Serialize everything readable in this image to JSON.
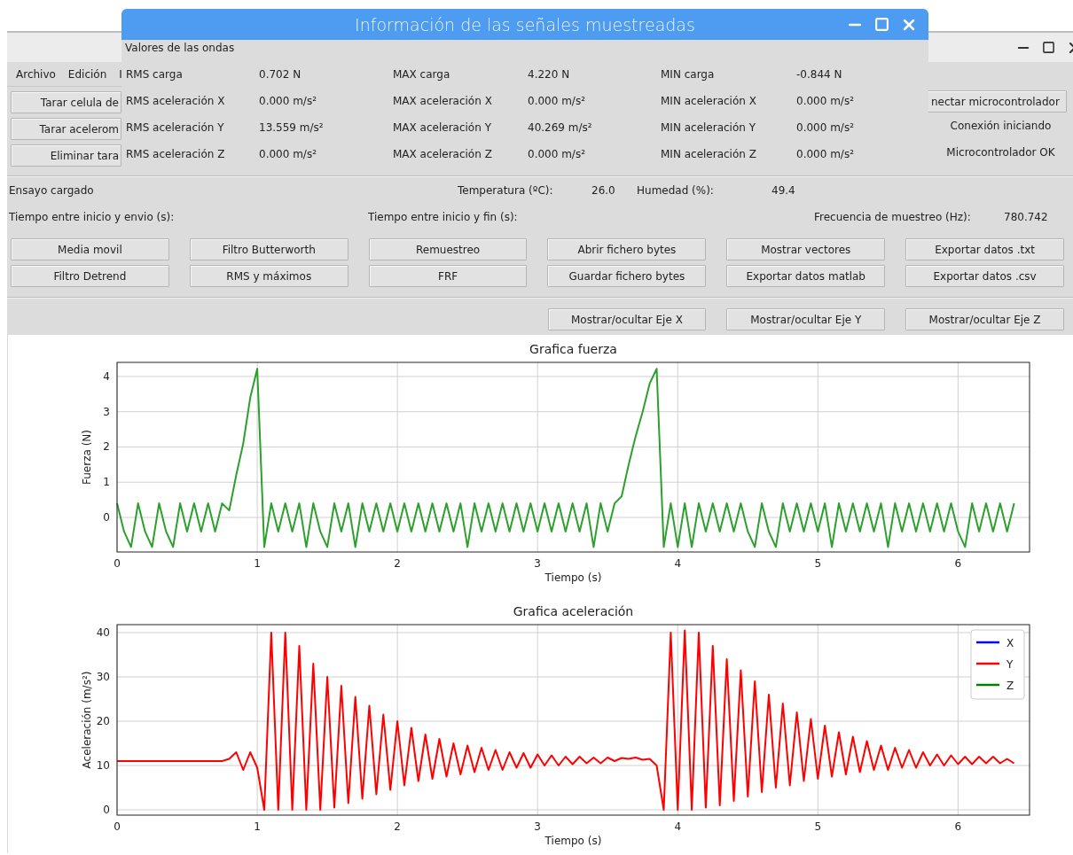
{
  "dialog": {
    "title": "Información de las señales muestreadas",
    "section": "Valores de las ondas",
    "rows": [
      [
        "RMS carga",
        "0.702 N",
        "MAX carga",
        "4.220 N",
        "MIN carga",
        "-0.844 N"
      ],
      [
        "RMS aceleración X",
        "0.000 m/s²",
        "MAX aceleración X",
        "0.000 m/s²",
        "MIN aceleración X",
        "0.000 m/s²"
      ],
      [
        "RMS aceleración Y",
        "13.559 m/s²",
        "MAX aceleración Y",
        "40.269 m/s²",
        "MIN aceleración Y",
        "0.000 m/s²"
      ],
      [
        "RMS aceleración Z",
        "0.000 m/s²",
        "MAX aceleración Z",
        "0.000 m/s²",
        "MIN aceleración Z",
        "0.000 m/s²"
      ]
    ]
  },
  "main_window": {
    "menu": [
      "Archivo",
      "Edición",
      "I"
    ],
    "left_buttons": [
      "Tarar celula de",
      "Tarar acelerom",
      "Eliminar tara"
    ],
    "right_button": "nectar microcontrolador",
    "status_labels": [
      "Conexión iniciando",
      "Microcontrolador OK"
    ]
  },
  "info": {
    "status": "Ensayo cargado",
    "temperature_label": "Temperatura (ºC):",
    "temperature_value": "26.0",
    "humidity_label": "Humedad (%):",
    "humidity_value": "49.4",
    "send_time_label": "Tiempo entre inicio y envio (s):",
    "end_time_label": "Tiempo entre inicio y fin (s):",
    "frequency_label": "Frecuencia de muestreo (Hz):",
    "frequency_value": "780.742"
  },
  "action_buttons": [
    "Media movil",
    "Filtro Butterworth",
    "Remuestreo",
    "Abrir fichero bytes",
    "Mostrar vectores",
    "Exportar datos .txt",
    "Filtro Detrend",
    "RMS y máximos",
    "FRF",
    "Guardar fichero bytes",
    "Exportar datos matlab",
    "Exportar datos .csv"
  ],
  "axis_buttons": [
    "Mostrar/ocultar Eje X",
    "Mostrar/ocultar Eje Y",
    "Mostrar/ocultar Eje Z"
  ],
  "charts": [
    {
      "chart_data": {
        "type": "line",
        "title": "Grafica fuerza",
        "xlabel": "Tiempo (s)",
        "ylabel": "Fuerza (N)",
        "xlim": [
          0,
          6.51
        ],
        "ylim": [
          -0.98,
          4.4
        ],
        "xticks": [
          0,
          1,
          2,
          3,
          4,
          5,
          6
        ],
        "yticks": [
          0,
          1,
          2,
          3,
          4
        ],
        "x": [
          0,
          0.05,
          0.1,
          0.15,
          0.2,
          0.25,
          0.3,
          0.35,
          0.4,
          0.45,
          0.5,
          0.55,
          0.6,
          0.65,
          0.7,
          0.75,
          0.8,
          0.85,
          0.9,
          0.95,
          1,
          1.05,
          1.1,
          1.15,
          1.2,
          1.25,
          1.3,
          1.35,
          1.4,
          1.45,
          1.5,
          1.55,
          1.6,
          1.65,
          1.7,
          1.75,
          1.8,
          1.85,
          1.9,
          1.95,
          2,
          2.05,
          2.1,
          2.15,
          2.2,
          2.25,
          2.3,
          2.35,
          2.4,
          2.45,
          2.5,
          2.55,
          2.6,
          2.65,
          2.7,
          2.75,
          2.8,
          2.85,
          2.9,
          2.95,
          3,
          3.05,
          3.1,
          3.15,
          3.2,
          3.25,
          3.3,
          3.35,
          3.4,
          3.45,
          3.5,
          3.55,
          3.6,
          3.65,
          3.7,
          3.75,
          3.8,
          3.85,
          3.9,
          3.95,
          4,
          4.05,
          4.1,
          4.15,
          4.2,
          4.25,
          4.3,
          4.35,
          4.4,
          4.45,
          4.5,
          4.55,
          4.6,
          4.65,
          4.7,
          4.75,
          4.8,
          4.85,
          4.9,
          4.95,
          5,
          5.05,
          5.1,
          5.15,
          5.2,
          5.25,
          5.3,
          5.35,
          5.4,
          5.45,
          5.5,
          5.55,
          5.6,
          5.65,
          5.7,
          5.75,
          5.8,
          5.85,
          5.9,
          5.95,
          6,
          6.05,
          6.1,
          6.15,
          6.2,
          6.25,
          6.3,
          6.35,
          6.4
        ],
        "grid": true,
        "series": [
          {
            "color": "#2ca02c",
            "values": [
              0.4,
              -0.4,
              -0.84,
              0.4,
              -0.4,
              -0.84,
              0.4,
              -0.4,
              -0.84,
              0.4,
              -0.4,
              0.4,
              -0.4,
              0.4,
              -0.4,
              0.4,
              0.2,
              1.2,
              2.1,
              3.4,
              4.22,
              -0.84,
              0.4,
              -0.4,
              0.4,
              -0.4,
              0.4,
              -0.84,
              0.4,
              -0.4,
              -0.84,
              0.4,
              -0.4,
              0.4,
              -0.84,
              0.4,
              -0.4,
              0.4,
              -0.4,
              0.4,
              -0.4,
              0.4,
              -0.4,
              0.4,
              -0.4,
              0.4,
              -0.4,
              0.4,
              -0.4,
              0.4,
              -0.84,
              0.4,
              -0.4,
              0.4,
              -0.4,
              0.4,
              -0.4,
              0.4,
              -0.4,
              0.4,
              -0.4,
              0.4,
              -0.4,
              0.4,
              -0.4,
              0.4,
              -0.4,
              0.4,
              -0.84,
              0.4,
              -0.4,
              0.4,
              0.6,
              1.5,
              2.3,
              3.0,
              3.8,
              4.22,
              -0.84,
              0.4,
              -0.84,
              0.4,
              -0.84,
              0.4,
              -0.4,
              0.4,
              -0.4,
              0.4,
              -0.4,
              0.4,
              -0.4,
              -0.84,
              0.4,
              -0.4,
              -0.84,
              0.4,
              -0.4,
              0.4,
              -0.4,
              0.4,
              -0.4,
              0.4,
              -0.84,
              0.4,
              -0.4,
              0.4,
              -0.4,
              0.4,
              -0.4,
              0.4,
              -0.84,
              0.4,
              -0.4,
              0.4,
              -0.4,
              0.4,
              -0.4,
              0.4,
              -0.4,
              0.4,
              -0.4,
              -0.84,
              0.4,
              -0.4,
              0.4,
              -0.4,
              0.4,
              -0.4,
              0.4
            ]
          }
        ]
      }
    },
    {
      "chart_data": {
        "type": "line",
        "title": "Grafica aceleración",
        "xlabel": "Tiempo (s)",
        "ylabel": "Aceleración (m/s²)",
        "xlim": [
          0,
          6.51
        ],
        "ylim": [
          -1.2,
          41.8
        ],
        "xticks": [
          0,
          1,
          2,
          3,
          4,
          5,
          6
        ],
        "yticks": [
          0,
          10,
          20,
          30,
          40
        ],
        "x": [
          0,
          0.05,
          0.1,
          0.15,
          0.2,
          0.25,
          0.3,
          0.35,
          0.4,
          0.45,
          0.5,
          0.55,
          0.6,
          0.65,
          0.7,
          0.75,
          0.8,
          0.85,
          0.9,
          0.95,
          1,
          1.05,
          1.1,
          1.15,
          1.2,
          1.25,
          1.3,
          1.35,
          1.4,
          1.45,
          1.5,
          1.55,
          1.6,
          1.65,
          1.7,
          1.75,
          1.8,
          1.85,
          1.9,
          1.95,
          2,
          2.05,
          2.1,
          2.15,
          2.2,
          2.25,
          2.3,
          2.35,
          2.4,
          2.45,
          2.5,
          2.55,
          2.6,
          2.65,
          2.7,
          2.75,
          2.8,
          2.85,
          2.9,
          2.95,
          3,
          3.05,
          3.1,
          3.15,
          3.2,
          3.25,
          3.3,
          3.35,
          3.4,
          3.45,
          3.5,
          3.55,
          3.6,
          3.65,
          3.7,
          3.75,
          3.8,
          3.85,
          3.9,
          3.95,
          4,
          4.05,
          4.1,
          4.15,
          4.2,
          4.25,
          4.3,
          4.35,
          4.4,
          4.45,
          4.5,
          4.55,
          4.6,
          4.65,
          4.7,
          4.75,
          4.8,
          4.85,
          4.9,
          4.95,
          5,
          5.05,
          5.1,
          5.15,
          5.2,
          5.25,
          5.3,
          5.35,
          5.4,
          5.45,
          5.5,
          5.55,
          5.6,
          5.65,
          5.7,
          5.75,
          5.8,
          5.85,
          5.9,
          5.95,
          6,
          6.05,
          6.1,
          6.15,
          6.2,
          6.25,
          6.3,
          6.35,
          6.4
        ],
        "grid": true,
        "series": [
          {
            "name": "X",
            "color": "#0000ff",
            "values": [
              null,
              null,
              null,
              null,
              null,
              null,
              null,
              null,
              null,
              null,
              null,
              null,
              null,
              null,
              null,
              null,
              null,
              null,
              null,
              null,
              null,
              null,
              null,
              null,
              null,
              null,
              null,
              null,
              null,
              null,
              null,
              null,
              null,
              null,
              null,
              null,
              null,
              null,
              null,
              null,
              null,
              null,
              null,
              null,
              null,
              null,
              null,
              null,
              null,
              null,
              null,
              null,
              null,
              null,
              null,
              null,
              null,
              null,
              null,
              null,
              null,
              null,
              null,
              null,
              null,
              null,
              null,
              null,
              null,
              null,
              null,
              null,
              null,
              null,
              null,
              null,
              null,
              null,
              null,
              null,
              null,
              null,
              null,
              null,
              null,
              null,
              null,
              null,
              null,
              null,
              null,
              null,
              null,
              null,
              null,
              null,
              null,
              null,
              null,
              null,
              null,
              null,
              null,
              null,
              null,
              null,
              null,
              null,
              null,
              null,
              null,
              null,
              null,
              null,
              null,
              null,
              null,
              null,
              null,
              null,
              null,
              null,
              null,
              null,
              null,
              null,
              null,
              null,
              null
            ]
          },
          {
            "name": "Y",
            "color": "#ff0000",
            "values": [
              11,
              11,
              11,
              11,
              11,
              11,
              11,
              11,
              11,
              11,
              11,
              11,
              11,
              11,
              11,
              11,
              11.5,
              13,
              9,
              13,
              9.5,
              0,
              40,
              0,
              40,
              0,
              37,
              0,
              33,
              0,
              30,
              0.5,
              28,
              1.5,
              25.5,
              2.5,
              23.5,
              3.5,
              21.5,
              4.5,
              20,
              5.5,
              18.5,
              6.5,
              17,
              7,
              16,
              7.5,
              15,
              8,
              14.5,
              8.5,
              14,
              9,
              13.5,
              9,
              13,
              9.5,
              12.8,
              9.5,
              12.5,
              10,
              12.3,
              10,
              12,
              10.3,
              12,
              10.5,
              11.8,
              10.5,
              11.8,
              11,
              11.7,
              11.5,
              11.8,
              11.3,
              11.5,
              10,
              0,
              40,
              0,
              40.5,
              0,
              40,
              0.5,
              37,
              1,
              34,
              2,
              31.5,
              3,
              29,
              4,
              26,
              5,
              24,
              5.5,
              22,
              6.5,
              20.5,
              7,
              19,
              7.5,
              17.5,
              8,
              16.5,
              8.5,
              15.5,
              9,
              14.5,
              9,
              14,
              9.5,
              13.5,
              9.5,
              13,
              10,
              12.5,
              10,
              12.3,
              10.3,
              12,
              10.3,
              12,
              10.5,
              12,
              10.5,
              11.5,
              10.5
            ]
          },
          {
            "name": "Z",
            "color": "#008000",
            "values": [
              null,
              null,
              null,
              null,
              null,
              null,
              null,
              null,
              null,
              null,
              null,
              null,
              null,
              null,
              null,
              null,
              null,
              null,
              null,
              null,
              null,
              null,
              null,
              null,
              null,
              null,
              null,
              null,
              null,
              null,
              null,
              null,
              null,
              null,
              null,
              null,
              null,
              null,
              null,
              null,
              null,
              null,
              null,
              null,
              null,
              null,
              null,
              null,
              null,
              null,
              null,
              null,
              null,
              null,
              null,
              null,
              null,
              null,
              null,
              null,
              null,
              null,
              null,
              null,
              null,
              null,
              null,
              null,
              null,
              null,
              null,
              null,
              null,
              null,
              null,
              null,
              null,
              null,
              null,
              null,
              null,
              null,
              null,
              null,
              null,
              null,
              null,
              null,
              null,
              null,
              null,
              null,
              null,
              null,
              null,
              null,
              null,
              null,
              null,
              null,
              null,
              null,
              null,
              null,
              null,
              null,
              null,
              null,
              null,
              null,
              null,
              null,
              null,
              null,
              null,
              null,
              null,
              null,
              null,
              null,
              null,
              null,
              null,
              null,
              null,
              null,
              null,
              null,
              null
            ]
          }
        ]
      }
    }
  ]
}
